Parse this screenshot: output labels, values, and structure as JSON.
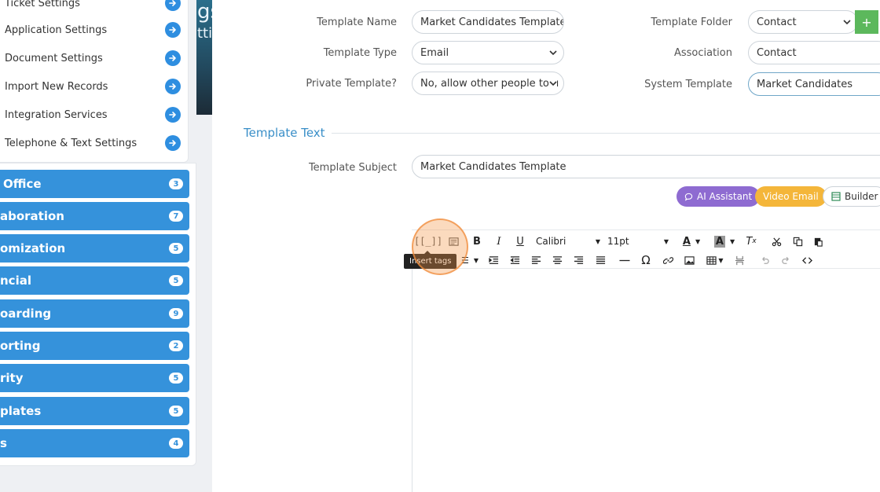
{
  "sidebar": {
    "settings_items": [
      {
        "label": "Ticket Settings"
      },
      {
        "label": "Application Settings"
      },
      {
        "label": "Document Settings"
      },
      {
        "label": "Import New Records"
      },
      {
        "label": "Integration Services"
      },
      {
        "label": "Telephone & Text Settings"
      }
    ],
    "categories": [
      {
        "label": "Office",
        "count": "3"
      },
      {
        "label": "aboration",
        "count": "7"
      },
      {
        "label": "omization",
        "count": "5"
      },
      {
        "label": "ncial",
        "count": "5"
      },
      {
        "label": "oarding",
        "count": "9"
      },
      {
        "label": "orting",
        "count": "2"
      },
      {
        "label": "rity",
        "count": "5"
      },
      {
        "label": "plates",
        "count": "5"
      },
      {
        "label": "s",
        "count": "4"
      }
    ],
    "hero_text_1": "gs",
    "hero_text_2": "tti"
  },
  "form": {
    "template_name_label": "Template Name",
    "template_name_value": "Market Candidates Template",
    "template_type_label": "Template Type",
    "template_type_value": "Email",
    "private_label": "Private Template?",
    "private_value": "No, allow other people to u",
    "template_folder_label": "Template Folder",
    "template_folder_value": "Contact",
    "association_label": "Association",
    "association_value": "Contact",
    "system_template_label": "System Template",
    "system_template_value": "Market Candidates",
    "add_button": "+"
  },
  "template_text": {
    "section_title": "Template Text",
    "subject_label": "Template Subject",
    "subject_value": "Market Candidates Template",
    "ai_assistant": "AI Assistant",
    "video_email": "Video Email",
    "builder": "Builder"
  },
  "editor": {
    "font_family": "Calibri",
    "font_size": "11pt",
    "tooltip": "Insert tags"
  },
  "colors": {
    "sidebar_blue": "#3592db",
    "accent_blue": "#3a8fc8",
    "ai_purple": "#8e6bd1",
    "video_yellow": "#f4b63a",
    "green": "#5cb85c"
  }
}
